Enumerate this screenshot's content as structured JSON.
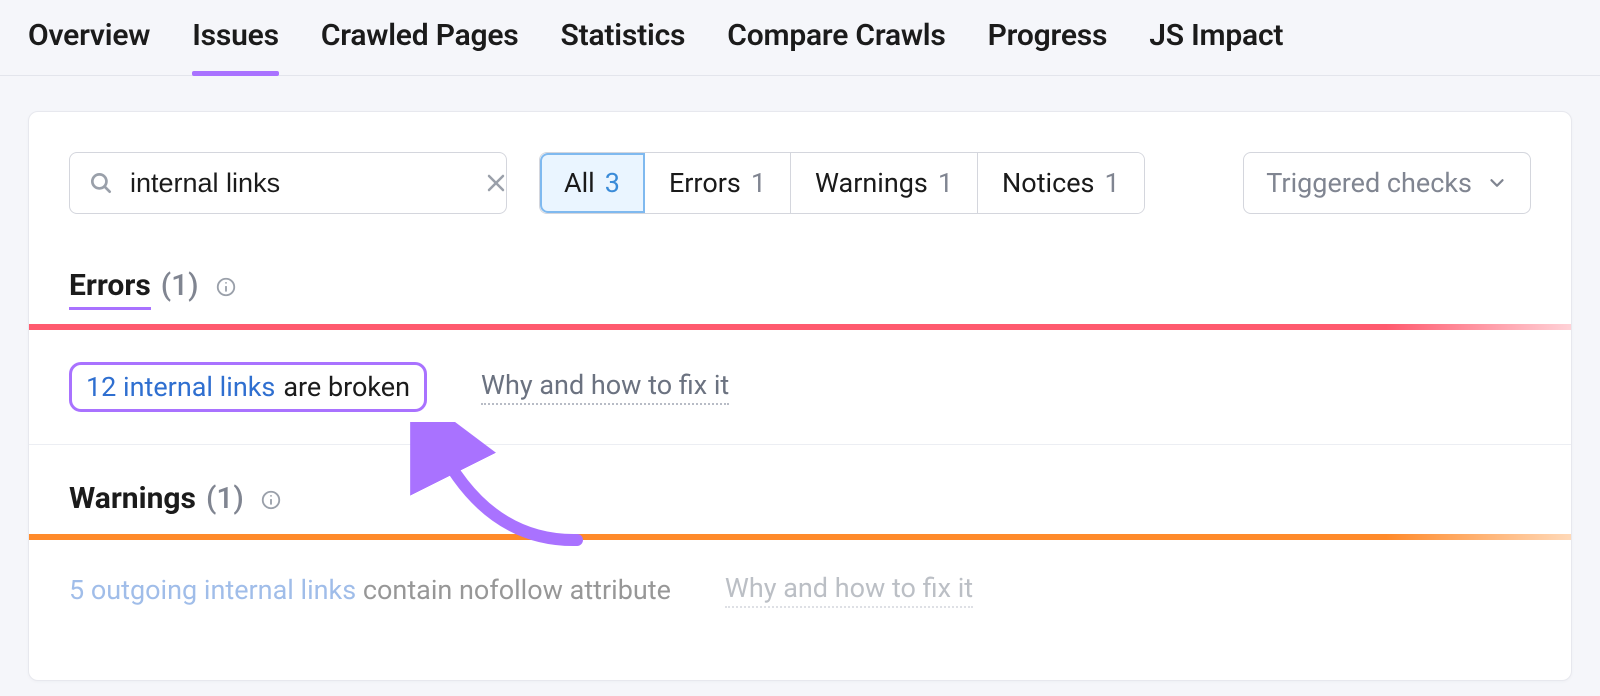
{
  "tabs": {
    "overview": "Overview",
    "issues": "Issues",
    "crawled": "Crawled Pages",
    "statistics": "Statistics",
    "compare": "Compare Crawls",
    "progress": "Progress",
    "jsimpact": "JS Impact"
  },
  "search": {
    "value": "internal links"
  },
  "filters": {
    "all": {
      "label": "All",
      "count": "3"
    },
    "errors": {
      "label": "Errors",
      "count": "1"
    },
    "warnings": {
      "label": "Warnings",
      "count": "1"
    },
    "notices": {
      "label": "Notices",
      "count": "1"
    }
  },
  "dropdown": {
    "triggered": "Triggered checks"
  },
  "sections": {
    "errors": {
      "title": "Errors",
      "count": "(1)"
    },
    "warnings": {
      "title": "Warnings",
      "count": "(1)"
    }
  },
  "issues": {
    "error1": {
      "link": "12 internal links",
      "text": " are broken",
      "fix": "Why and how to fix it"
    },
    "warn1": {
      "link": "5 outgoing internal links",
      "text": " contain nofollow attribute",
      "fix": "Why and how to fix it"
    }
  }
}
